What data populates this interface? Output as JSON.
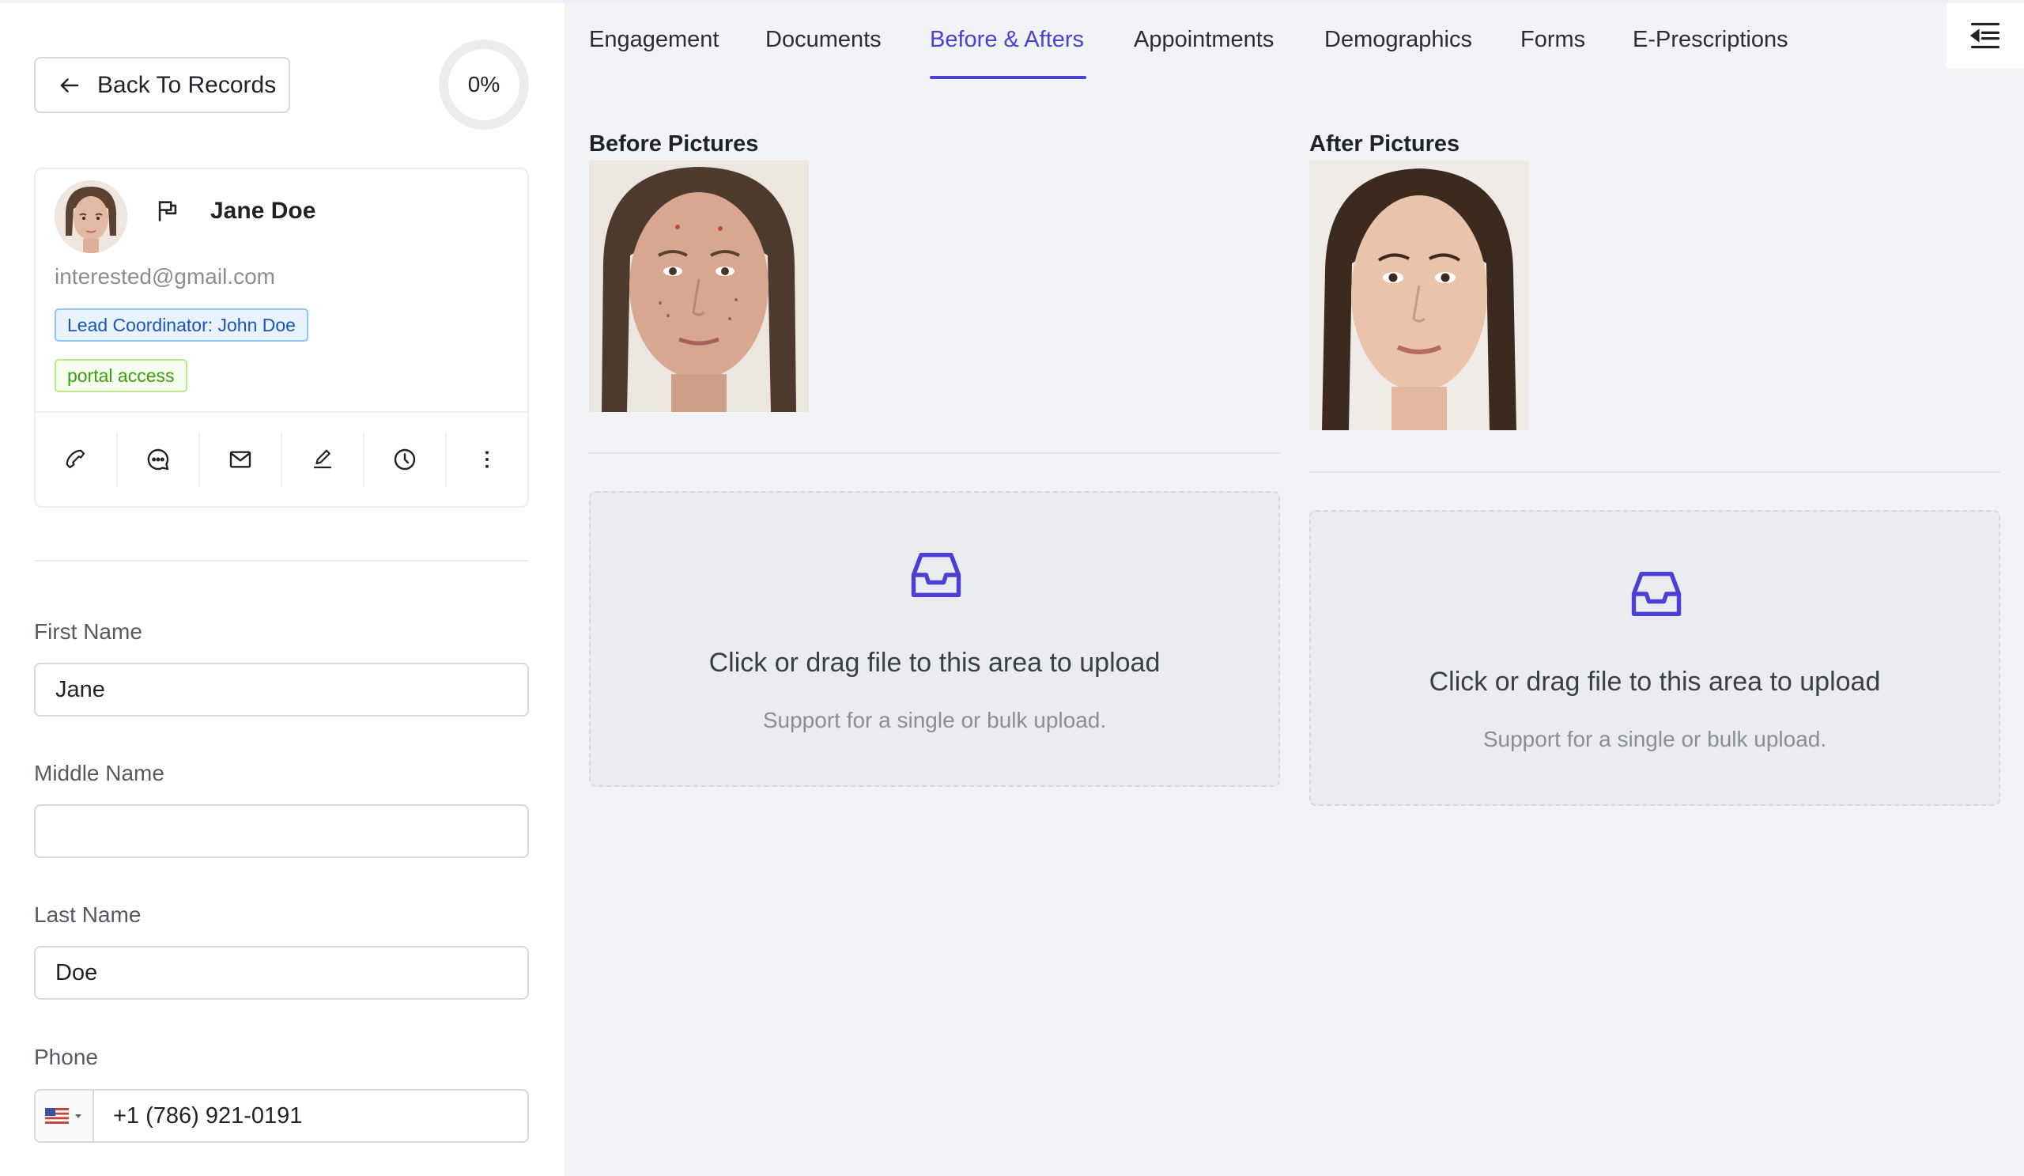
{
  "sidebar": {
    "back_label": "Back To Records",
    "progress": "0%",
    "profile": {
      "name": "Jane Doe",
      "email": "interested@gmail.com",
      "tags": [
        "Lead Coordinator: John Doe",
        "portal access"
      ]
    },
    "actions": [
      "phone-icon",
      "chat-icon",
      "mail-icon",
      "edit-icon",
      "clock-icon",
      "more-icon"
    ],
    "fields": {
      "first_name_label": "First Name",
      "first_name_value": "Jane",
      "middle_name_label": "Middle Name",
      "middle_name_value": "",
      "last_name_label": "Last Name",
      "last_name_value": "Doe",
      "phone_label": "Phone",
      "phone_value": "+1 (786) 921-0191"
    }
  },
  "tabs": [
    {
      "label": "Engagement"
    },
    {
      "label": "Documents"
    },
    {
      "label": "Before & Afters",
      "active": true
    },
    {
      "label": "Appointments"
    },
    {
      "label": "Demographics"
    },
    {
      "label": "Forms"
    },
    {
      "label": "E-Prescriptions"
    }
  ],
  "before": {
    "title": "Before Pictures",
    "upload_text": "Click or drag file to this area to upload",
    "upload_hint": "Support for a single or bulk upload."
  },
  "after": {
    "title": "After Pictures",
    "upload_text": "Click or drag file to this area to upload",
    "upload_hint": "Support for a single or bulk upload."
  },
  "colors": {
    "accent": "#4b3fd6",
    "tag_blue": "#1a56b4",
    "tag_green": "#389e0d"
  }
}
